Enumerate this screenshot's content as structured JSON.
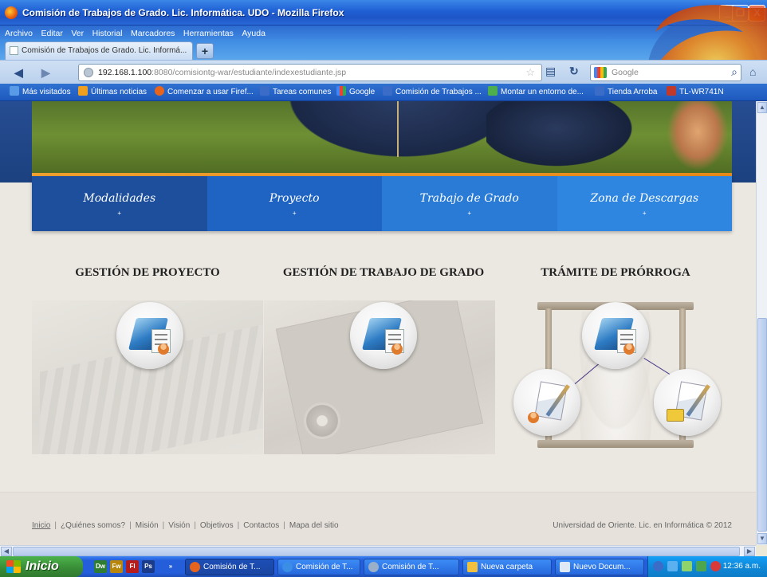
{
  "window": {
    "title": "Comisión de Trabajos de Grado. Lic. Informática. UDO - Mozilla Firefox",
    "minimize": "_",
    "maximize": "❐",
    "close": "X"
  },
  "menubar": [
    "Archivo",
    "Editar",
    "Ver",
    "Historial",
    "Marcadores",
    "Herramientas",
    "Ayuda"
  ],
  "tab": {
    "label": "Comisión de Trabajos de Grado. Lic. Informá...",
    "new_tab": "+"
  },
  "navbar": {
    "url_host": "192.168.1.100",
    "url_rest": ":8080/comisiontg-war/estudiante/indexestudiante.jsp",
    "search_placeholder": "Google"
  },
  "bookmarks": [
    {
      "label": "Más visitados",
      "color": "#5a9be8"
    },
    {
      "label": "Últimas noticias",
      "color": "#f0a020"
    },
    {
      "label": "Comenzar a usar Firef...",
      "color": "#e6641c"
    },
    {
      "label": "Tareas comunes",
      "color": "#3a6cc8"
    },
    {
      "label": "Google",
      "color": "#4285f4"
    },
    {
      "label": "Comisión de Trabajos ...",
      "color": "#3a6cc8"
    },
    {
      "label": "Montar un entorno de...",
      "color": "#4cae4c"
    },
    {
      "label": "Tienda Arroba",
      "color": "#3a6cc8"
    },
    {
      "label": "TL-WR741N",
      "color": "#c0392b"
    }
  ],
  "site_nav": [
    {
      "label": "Modalidades",
      "marker": "+",
      "color": "#1d4f9c"
    },
    {
      "label": "Proyecto",
      "marker": "+",
      "color": "#1f64c2"
    },
    {
      "label": "Trabajo de Grado",
      "marker": "+",
      "color": "#2a7bd5"
    },
    {
      "label": "Zona de Descargas",
      "marker": "+",
      "color": "#2f86e0"
    }
  ],
  "sections": [
    {
      "title": "GESTIÓN DE PROYECTO"
    },
    {
      "title": "GESTIÓN DE TRABAJO DE GRADO"
    },
    {
      "title": "TRÁMITE DE PRÓRROGA"
    }
  ],
  "footer": {
    "links": [
      "Inicio",
      "¿Quiénes somos?",
      "Misión",
      "Visión",
      "Objetivos",
      "Contactos",
      "Mapa del sitio"
    ],
    "separator": "|",
    "copyright": "Universidad de Oriente. Lic. en Informática © 2012"
  },
  "taskbar": {
    "start": "Inicio",
    "quick_launch": [
      {
        "label": "Dw",
        "color": "#2e7d32"
      },
      {
        "label": "Fw",
        "color": "#b8860b"
      },
      {
        "label": "Fl",
        "color": "#b71c1c"
      },
      {
        "label": "Ps",
        "color": "#1a3a8a"
      }
    ],
    "more": "»",
    "buttons": [
      {
        "label": "Comisión de T...",
        "icon_color": "#e6641c",
        "active": true
      },
      {
        "label": "Comisión de T...",
        "icon_color": "#3a8ee6",
        "active": false
      },
      {
        "label": "Comisión de T...",
        "icon_color": "#9ab0c8",
        "active": false
      },
      {
        "label": "Nueva carpeta",
        "icon_color": "#f0c040",
        "active": false
      },
      {
        "label": "Nuevo Docum...",
        "icon_color": "#dfe9f6",
        "active": false
      }
    ],
    "clock": "12:36 a.m."
  }
}
